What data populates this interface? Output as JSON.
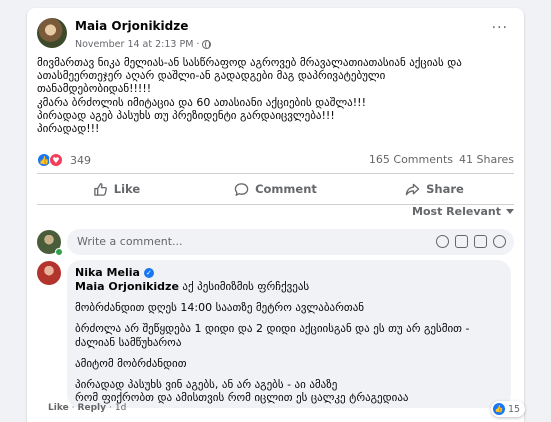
{
  "post": {
    "author": "Maia Orjonikidze",
    "date": "November 14 at 2:13 PM",
    "separator": "·",
    "more": "···",
    "lines": [
      "მივმართავ ნიკა მელიას-ან სასწრაფოდ აგროვებ მრავალათიათასიან აქციას და",
      "ათასმეერთეჯერ აღარ დაშლი-ან გადადგები მაგ დაპრივატებული",
      "თანამდებობიდან!!!!!",
      "კმარა ბრძოლის იმიტაცია და 60 ათასიანი აქციების დაშლა!!!",
      "პირადად აგებ პასუხს თუ პრეზიდენტი გარდაიცვლება!!!",
      "პირადად!!!"
    ]
  },
  "reactions": {
    "count": "349",
    "like_glyph": "👍",
    "love_glyph": "♥"
  },
  "stats": {
    "comments": "165 Comments",
    "shares": "41 Shares"
  },
  "actions": {
    "like": "Like",
    "comment": "Comment",
    "share": "Share"
  },
  "sort": {
    "label": "Most Relevant"
  },
  "composer": {
    "placeholder": "Write a comment..."
  },
  "comment": {
    "author": "Nika Melia",
    "verified_glyph": "✓",
    "mention": "Maia Orjonikidze",
    "first_line_rest": "აქ პესიმიზმის ფრჩქვეას",
    "lines": [
      "მობრძანდით დღეს 14:00 საათზე მეტრო ავლაბართან",
      "ბრძოლა არ შეწყდება 1 დიდი და 2 დიდი აქციისგან და ეს თუ არ გესმით -",
      "ძალიან სამწუხაროა",
      "ამიტომ მობრძანდით",
      "პირადად პასუხს ვინ აგებს, ან არ აგებს - აი ამაზე",
      "რომ ფიქრობთ და ამისთვის რომ იცლით ეს ცალკე ტრაგედიაა"
    ],
    "like": "Like",
    "reply": "Reply",
    "dot": "·",
    "time": "1d",
    "reaction_count": "15"
  },
  "colors": {
    "accent": "#1877f2",
    "love": "#f33e58",
    "online": "#31a24c",
    "muted": "#65676b"
  }
}
